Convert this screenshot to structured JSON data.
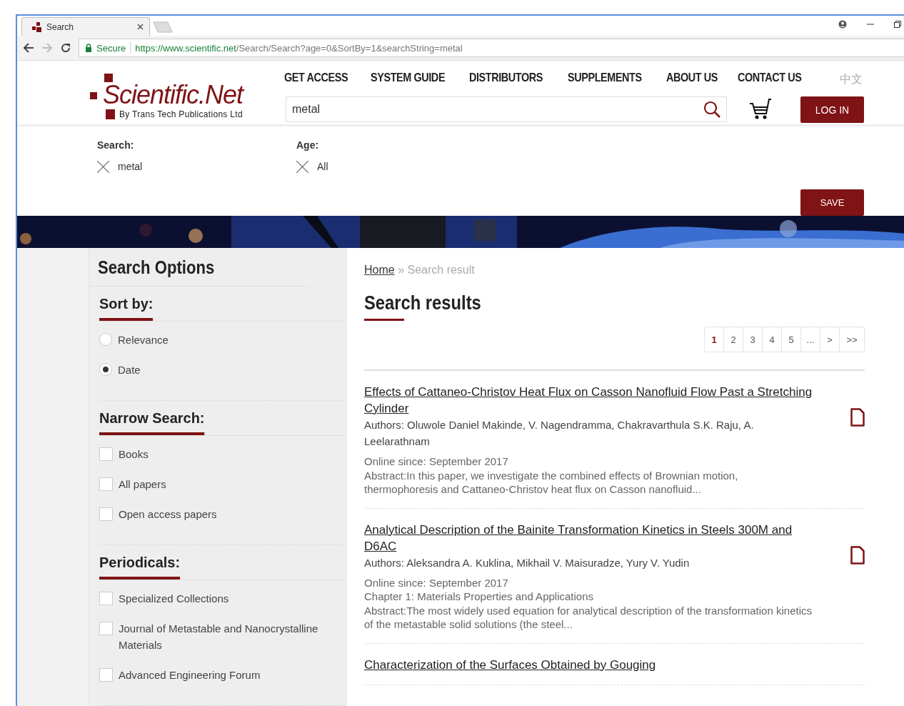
{
  "browser": {
    "tab_title": "Search",
    "secure_label": "Secure",
    "url_host": "https://www.scientific.net",
    "url_path": "/Search/Search?age=0&SortBy=1&searchString=metal"
  },
  "header": {
    "logo": {
      "name": "Scientific.Net",
      "tagline": "By Trans Tech Publications Ltd"
    },
    "nav": [
      "GET ACCESS",
      "SYSTEM GUIDE",
      "DISTRIBUTORS",
      "SUPPLEMENTS",
      "ABOUT US",
      "CONTACT US"
    ],
    "language": "中文",
    "search": {
      "value": "metal"
    },
    "login": "LOG IN"
  },
  "filters": [
    {
      "label": "Search:",
      "value": "metal"
    },
    {
      "label": "Age:",
      "value": "All"
    }
  ],
  "save": "SAVE",
  "sidebar": {
    "title": "Search Options",
    "sections": [
      {
        "heading": "Sort by:",
        "kind": "radio",
        "options": [
          {
            "label": "Relevance",
            "selected": false
          },
          {
            "label": "Date",
            "selected": true
          }
        ]
      },
      {
        "heading": "Narrow Search:",
        "kind": "checkbox",
        "options": [
          {
            "label": "Books",
            "checked": false
          },
          {
            "label": "All papers",
            "checked": false
          },
          {
            "label": "Open access papers",
            "checked": false
          }
        ]
      },
      {
        "heading": "Periodicals:",
        "kind": "checkbox",
        "options": [
          {
            "label": "Specialized Collections",
            "checked": false
          },
          {
            "label": "Journal of Metastable and Nanocrystalline Materials",
            "checked": false
          },
          {
            "label": "Advanced Engineering Forum",
            "checked": false
          }
        ]
      }
    ]
  },
  "breadcrumb": {
    "items": [
      {
        "label": "Home",
        "kind": "link"
      },
      {
        "label": "Search result",
        "kind": "current"
      }
    ],
    "separator": "»"
  },
  "results_title": "Search results",
  "pagination": [
    {
      "label": "1",
      "selected": true
    },
    {
      "label": "2",
      "selected": false
    },
    {
      "label": "3",
      "selected": false
    },
    {
      "label": "4",
      "selected": false
    },
    {
      "label": "5",
      "selected": false
    },
    {
      "label": "...",
      "selected": false
    },
    {
      "label": ">",
      "selected": false
    },
    {
      "label": ">>",
      "selected": false
    }
  ],
  "results": [
    {
      "title": "Effects of Cattaneo-Christov Heat Flux on Casson Nanofluid Flow Past a Stretching Cylinder",
      "authors": "Authors: Oluwole Daniel Makinde, V. Nagendramma, Chakravarthula S.K. Raju, A. Leelarathnam",
      "online": "Online since: September 2017",
      "details": [
        "Abstract:In this paper, we investigate the combined effects of Brownian motion, thermophoresis and Cattaneo-Christov heat flux on Casson nanofluid..."
      ]
    },
    {
      "title": "Analytical Description of the Bainite Transformation Kinetics in Steels 300M and D6AC",
      "authors": "Authors: Aleksandra A. Kuklina, Mikhail V. Maisuradze, Yury V. Yudin",
      "online": "Online since: September 2017",
      "details": [
        "Chapter 1: Materials Properties and Applications",
        "Abstract:The most widely used equation for analytical description of the transformation kinetics of the metastable solid solutions (the steel..."
      ]
    },
    {
      "title": "Characterization of the Surfaces Obtained by Gouging"
    }
  ]
}
